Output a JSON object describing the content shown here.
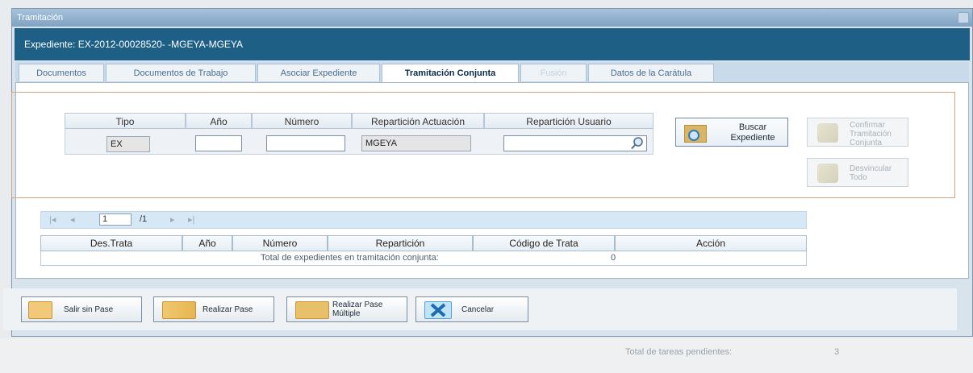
{
  "window": {
    "title": "Tramitación"
  },
  "header": {
    "expediente": "Expediente: EX-2012-00028520- -MGEYA-MGEYA"
  },
  "tabs": [
    {
      "label": "Documentos"
    },
    {
      "label": "Documentos de Trabajo"
    },
    {
      "label": "Asociar Expediente"
    },
    {
      "label": "Tramitación Conjunta"
    },
    {
      "label": "Fusión"
    },
    {
      "label": "Datos de la Carátula"
    }
  ],
  "search": {
    "headers": [
      "Tipo",
      "Año",
      "Número",
      "Repartición Actuación",
      "Repartición Usuario"
    ],
    "tipo_value": "EX",
    "anio_value": "",
    "numero_value": "",
    "reparticion_actuacion_value": "MGEYA",
    "reparticion_usuario_value": ""
  },
  "buttons": {
    "buscar": "Buscar Expediente",
    "confirmar": "Confirmar Tramitación Conjunta",
    "desvincular": "Desvincular Todo"
  },
  "pager": {
    "page": "1",
    "total": "/1"
  },
  "results": {
    "headers": [
      "Des.Trata",
      "Año",
      "Número",
      "Repartición",
      "Código de Trata",
      "Acción"
    ],
    "total_label": "Total de expedientes en tramitación conjunta:",
    "total_value": "0"
  },
  "actions": {
    "salir": "Salir sin Pase",
    "realizar": "Realizar Pase",
    "multiple": "Realizar Pase Múltiple",
    "cancelar": "Cancelar"
  },
  "background": {
    "pending_label": "Total de tareas pendientes:",
    "pending_value": "3"
  }
}
